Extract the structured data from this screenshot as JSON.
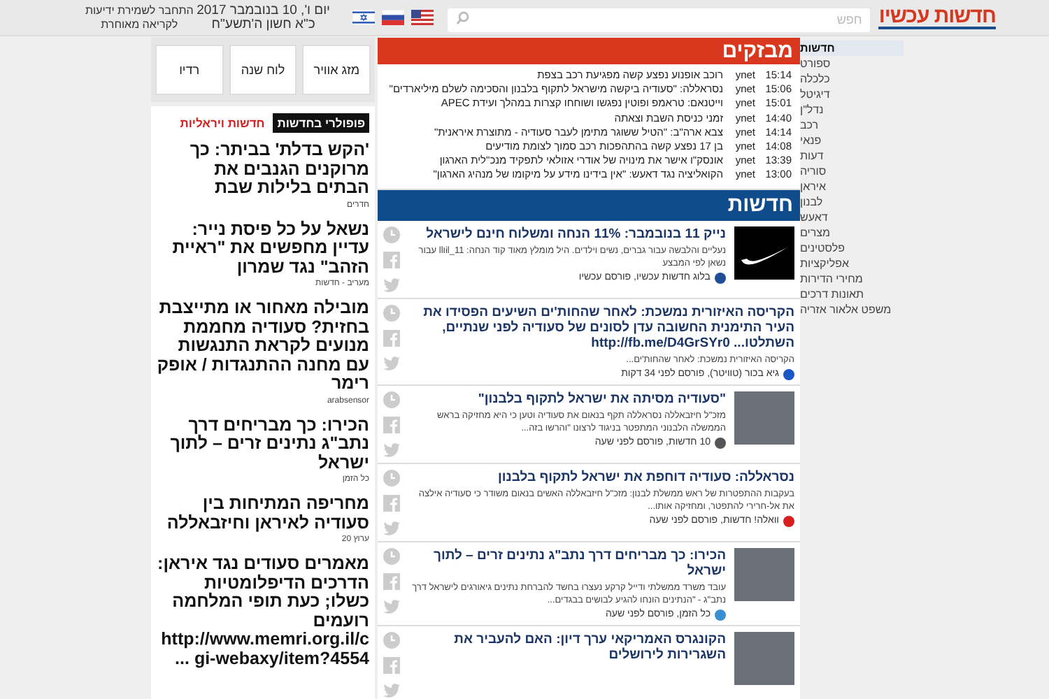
{
  "header": {
    "logo": "חדשות עכשיו",
    "search": {
      "placeholder": "חפש"
    },
    "date": "יום ו', 10 בנובמבר 2017",
    "hebrew_date": "כ\"א חשון ה'תשע\"ח",
    "login_line_1": "התחבר לשמירת ידיעות",
    "login_line_2": "לקריאה מאוחרת"
  },
  "sidebar": {
    "items": [
      {
        "label": "חדשות",
        "selected": true
      },
      {
        "label": "ספורט",
        "selected": false
      },
      {
        "label": "כלכלה",
        "selected": false
      },
      {
        "label": "דיגיטל",
        "selected": false
      },
      {
        "label": "נדל\"ן",
        "selected": false
      },
      {
        "label": "רכב",
        "selected": false
      },
      {
        "label": "פנאי",
        "selected": false
      },
      {
        "label": "דעות",
        "selected": false
      },
      {
        "label": "סוריה",
        "selected": false
      },
      {
        "label": "איראן",
        "selected": false
      },
      {
        "label": "לבנון",
        "selected": false
      },
      {
        "label": "דאעש",
        "selected": false
      },
      {
        "label": "מצרים",
        "selected": false
      },
      {
        "label": "פלסטינים",
        "selected": false
      },
      {
        "label": "אפליקציות",
        "selected": false
      },
      {
        "label": "מחירי הדירות",
        "selected": false
      },
      {
        "label": "תאונות דרכים",
        "selected": false
      },
      {
        "label": "משפט אלאור אזריה",
        "selected": false
      }
    ]
  },
  "breaking": {
    "title": "מבזקים",
    "items": [
      {
        "time": "15:14",
        "source": "ynet",
        "text": "רוכב אופנוע נפצע קשה מפגיעת רכב בצפת"
      },
      {
        "time": "15:06",
        "source": "ynet",
        "text": "נסראללה: \"סעודיה ביקשה מישראל לתקוף בלבנון והסכימה לשלם מיליארדים\""
      },
      {
        "time": "15:01",
        "source": "ynet",
        "text": "וייטנאם: טראמפ ופוטין נפגשו ושוחחו קצרות במהלך ועידת APEC"
      },
      {
        "time": "14:40",
        "source": "ynet",
        "text": "זמני כניסת השבת וצאתה"
      },
      {
        "time": "14:14",
        "source": "ynet",
        "text": "צבא ארה\"ב: \"הטיל ששוגר מתימן לעבר סעודיה - מתוצרת איראנית\""
      },
      {
        "time": "14:08",
        "source": "ynet",
        "text": "בן 17 נפצע קשה בהתהפכות רכב סמוך לצומת מודיעים"
      },
      {
        "time": "13:39",
        "source": "ynet",
        "text": "אונסק\"ו אישר את מינויה של אודרי אזולאי לתפקיד מנכ\"לית הארגון"
      },
      {
        "time": "13:00",
        "source": "ynet",
        "text": "הקואליציה נגד דאעש: \"אין בידינו מידע על מיקומו של מנהיג הארגון\""
      }
    ]
  },
  "news": {
    "title": "חדשות",
    "cards": [
      {
        "kind": "logo",
        "title": "נייק 11 בנובמבר: 11% הנחה ומשלוח חינם לישראל",
        "description": "נעליים והלבשה עבור גברים, נשים וילדים. היל מומלץ מאוד קוד הנחה: il_11וll עבור נשאן לפי המבצע",
        "source": "בלוג חדשות עכשיו, פורסם עכשיו",
        "color": "#1f4e96"
      },
      {
        "kind": "none",
        "title": "הקריסה האיזורית נמשכת: לאחר שהחות'ים השיעים הפסידו את העיר התימנית החשובה עדן לסונים של סעודיה לפני שנתיים, השתלטו... http://fb.me/D4GrSYr0",
        "description": "הקריסה האיזורית נמשכת: לאחר שהחות'ים...",
        "source": "גיא בכור (טוויטר), פורסם לפני 34 דקות",
        "color": "#1a56c4"
      },
      {
        "kind": "photo",
        "title": "\"סעודיה מסיתה את ישראל לתקוף בלבנון\"",
        "description": "מזכ\"ל חיזבאללה נסראללה תקף בנאום את סעודיה וטען כי היא מחזיקה בראש הממשלה הלבנוני המתפטר בניגוד לרצונו \"והרשו בזה...",
        "source": "10 חדשות, פורסם לפני שעה",
        "color": "#555555"
      },
      {
        "kind": "none",
        "title": "נסראללה: סעודיה דוחפת את ישראל לתקוף בלבנון",
        "description": "בעקבות ההתפטרות של ראש ממשלת לבנון: מזכ\"ל חיזבאללה האשים בנאום משודר כי סעודיה אילצה את אל-חרירי להתפטר, ומחזיקה אותו...",
        "source": "וואלה! חדשות, פורסם לפני שעה",
        "color": "#d6201f"
      },
      {
        "kind": "photo",
        "title": "הכירו: כך מבריחים דרך נתב\"ג נתינים זרים – לתוך ישראל",
        "description": "עובד משרד ממשלתי ודייל קרקע נעצרו בחשד להברחת נתינים גיאורגים לישראל דרך נתב\"ג - \"הנתינים הונחו להגיע לבושים בבגדים...",
        "source": "כל הזמן, פורסם לפני שעה",
        "color": "#3a8fd0"
      },
      {
        "kind": "photo",
        "title": "הקונגרס האמריקאי ערך דיון: האם להעביר את השגרירות לירושלים"
      }
    ]
  },
  "quick_links": [
    "מזג אוויר",
    "לוח שנה",
    "רדיו"
  ],
  "popular": {
    "tabs": [
      {
        "label": "פופולרי בחדשות",
        "selected": true
      },
      {
        "label": "חדשות ויראליות",
        "selected": false
      }
    ],
    "items": [
      {
        "title": "'הקש בדלת' בביתר: כך מרוקנים הגנבים את הבתים בלילות שבת",
        "source": "חדרים"
      },
      {
        "title": "נשאל על כל פיסת נייר: עדיין מחפשים את \"ראיית הזהב\" נגד שמרון",
        "source": "מעריב - חדשות"
      },
      {
        "title": "מובילה מאחור או מתייצבת בחזית? סעודיה מחממת מנועים לקראת התנגשות עם מחנה ההתנגדות / אופק רימר",
        "source": "arabsensor"
      },
      {
        "title": "הכירו: כך מבריחים דרך נתב\"ג נתינים זרים – לתוך ישראל",
        "source": "כל הזמן"
      },
      {
        "title": "מחריפה המתיחות בין סעודיה לאיראן וחיזבאללה",
        "source": "ערוץ 20"
      },
      {
        "title": "מאמרים סעודים נגד איראן: הדרכים הדיפלומטיות כשלו; כעת תופי המלחמה רועמים http://www.memri.org.il/cgi-webaxy/item?4554 ..."
      }
    ]
  }
}
